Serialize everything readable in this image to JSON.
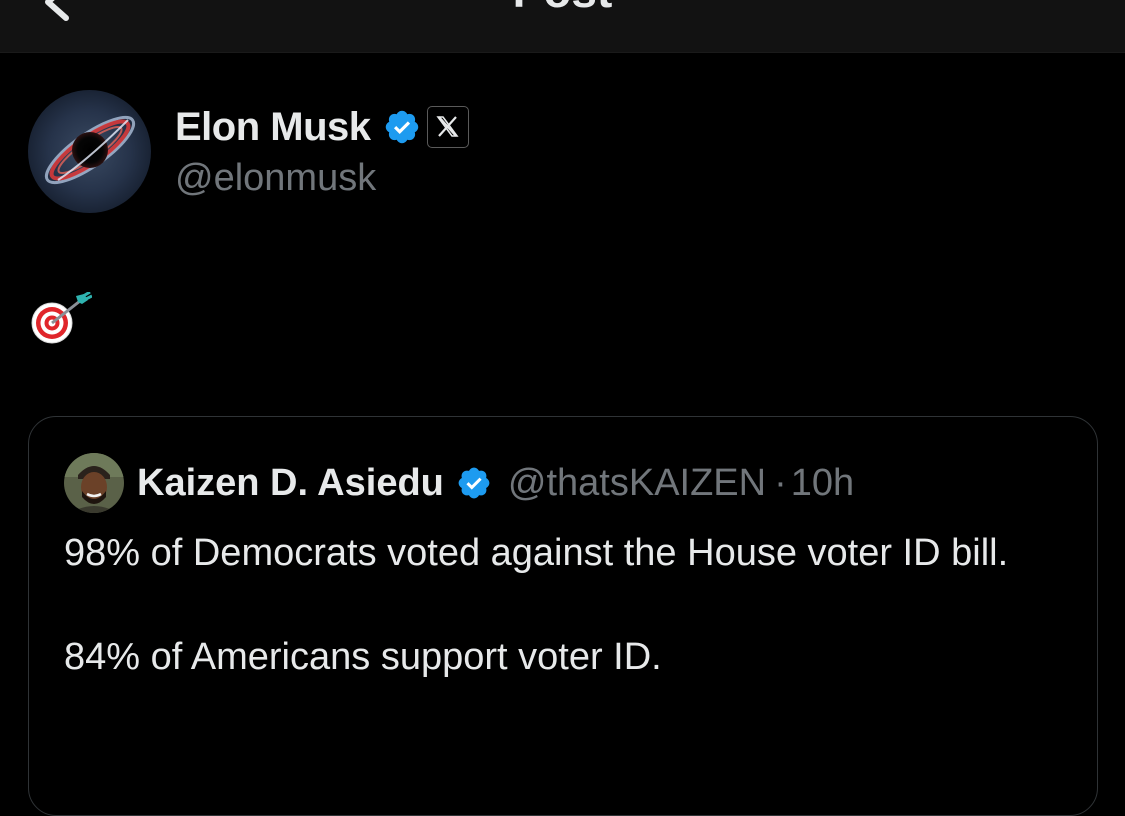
{
  "header": {
    "title": "Post",
    "back_icon": "chevron-left-icon"
  },
  "post": {
    "author": {
      "name": "Elon Musk",
      "handle": "@elonmusk",
      "verified": true,
      "affiliate_badge": "x-logo-icon"
    },
    "text": "🎯",
    "quote": {
      "author": {
        "name": "Kaizen D. Asiedu",
        "handle": "@thatsKAIZEN",
        "verified": true
      },
      "separator": "·",
      "time": "10h",
      "paragraphs": [
        "98% of Democrats voted against the House voter ID bill.",
        "84% of Americans support voter ID."
      ]
    }
  },
  "colors": {
    "background": "#000000",
    "text": "#e7e9ea",
    "secondary_text": "#71767b",
    "verified_blue": "#1d9bf0",
    "border": "#2f3336"
  }
}
